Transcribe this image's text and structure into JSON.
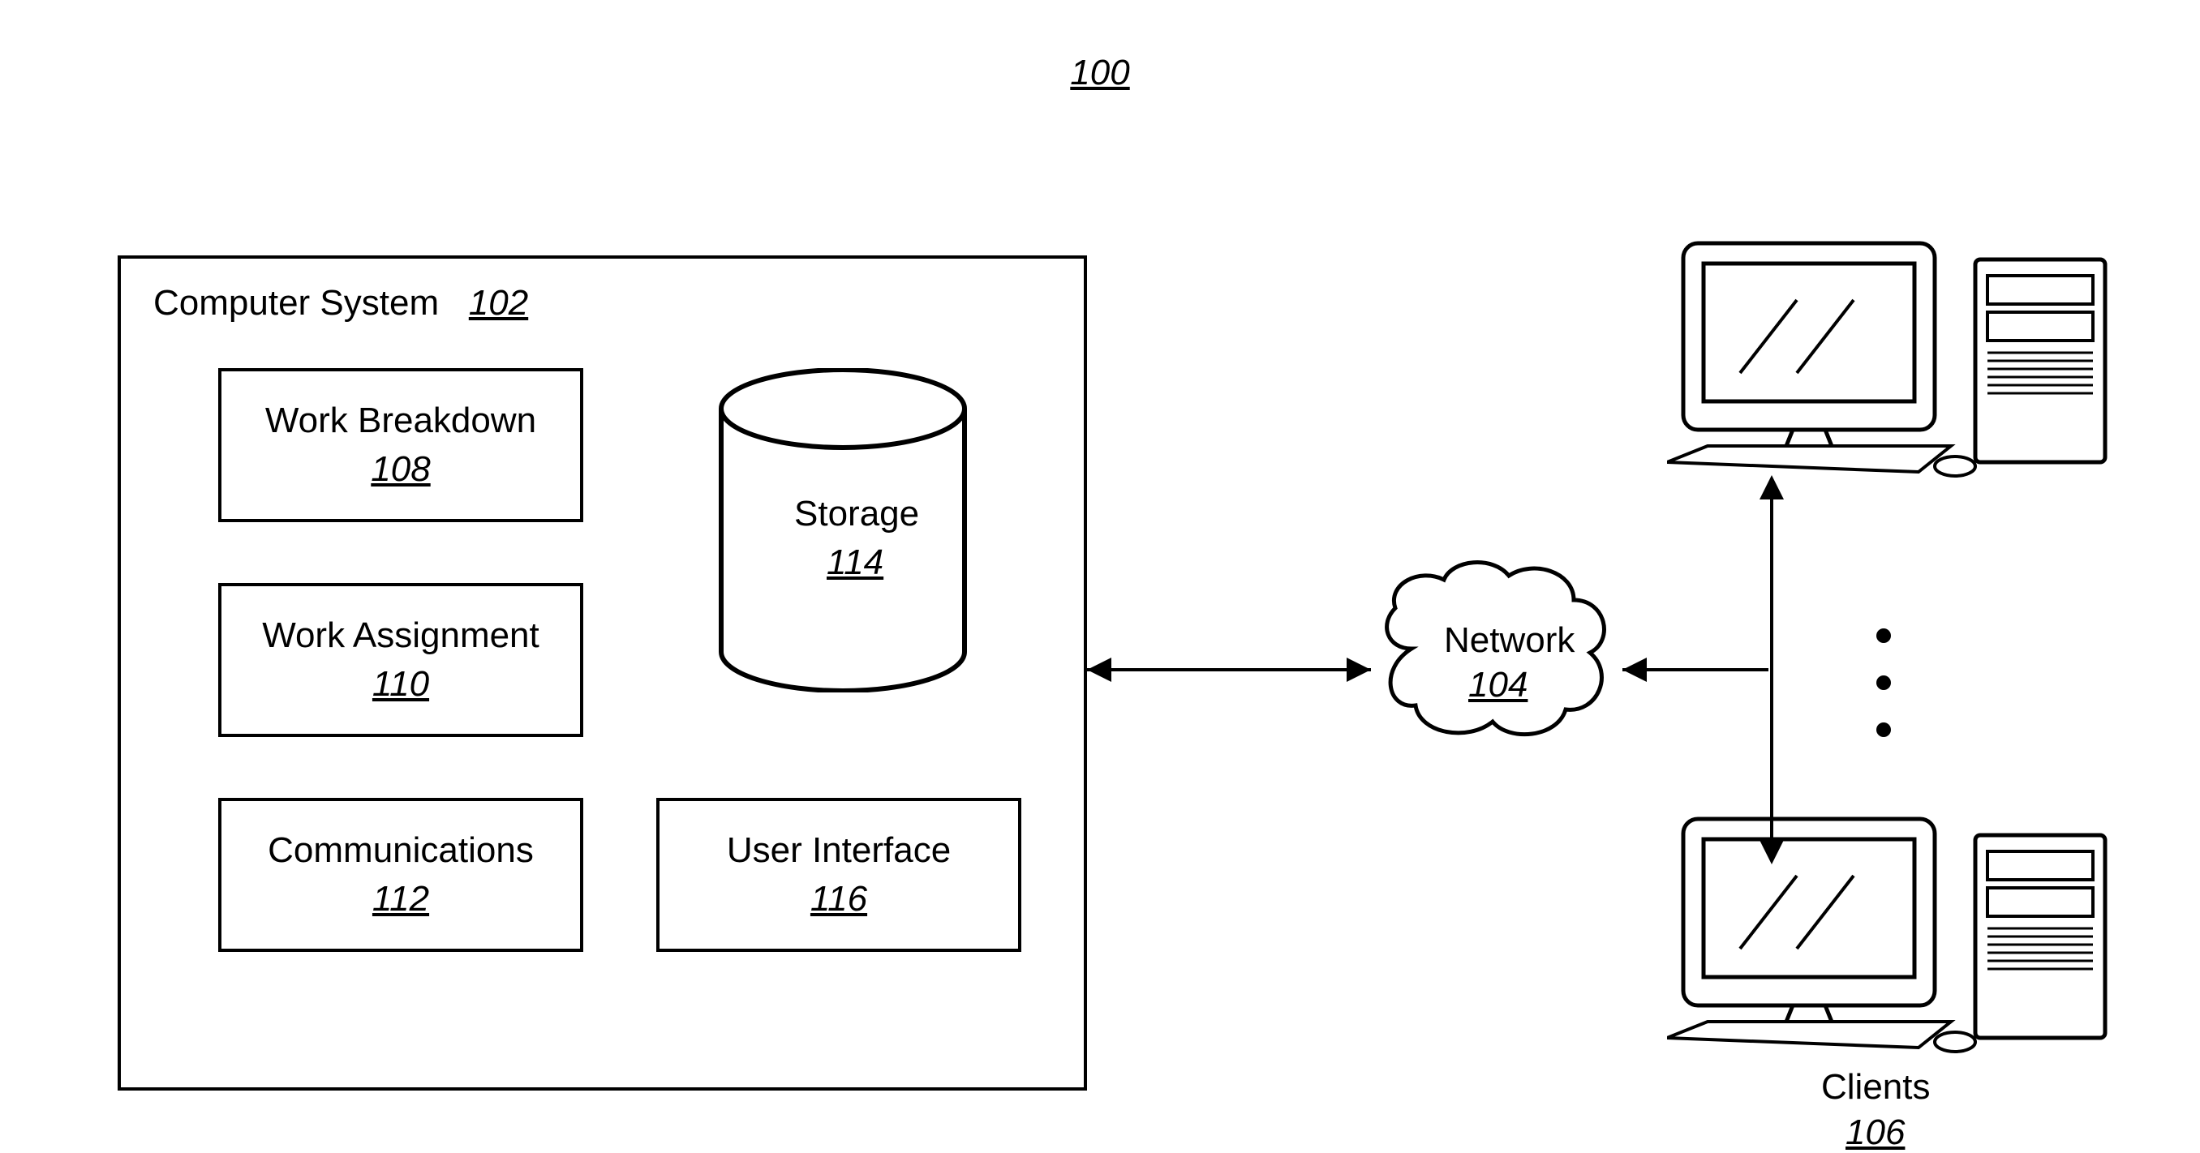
{
  "figure": {
    "number": "100"
  },
  "computerSystem": {
    "title": "Computer System",
    "ref": "102",
    "modules": {
      "workBreakdown": {
        "label": "Work Breakdown",
        "ref": "108"
      },
      "workAssignment": {
        "label": "Work Assignment",
        "ref": "110"
      },
      "communications": {
        "label": "Communications",
        "ref": "112"
      },
      "userInterface": {
        "label": "User Interface",
        "ref": "116"
      },
      "storage": {
        "label": "Storage",
        "ref": "114"
      }
    }
  },
  "network": {
    "label": "Network",
    "ref": "104"
  },
  "clients": {
    "label": "Clients",
    "ref": "106"
  }
}
